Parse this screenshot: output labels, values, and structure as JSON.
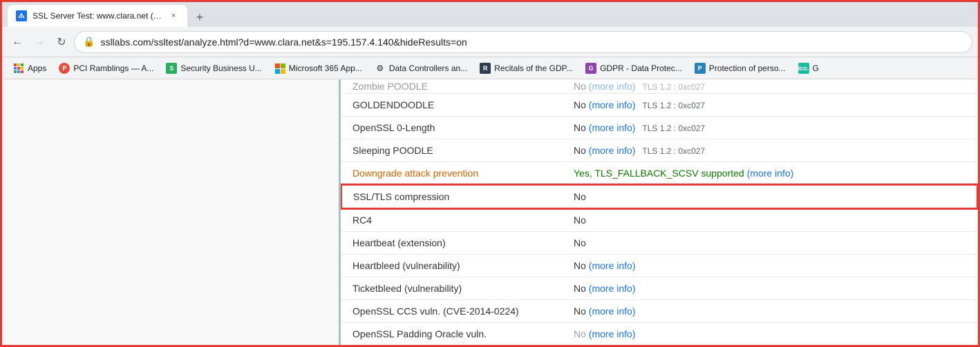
{
  "browser": {
    "tab": {
      "favicon_text": "S",
      "title": "SSL Server Test: www.clara.net (P...",
      "close_label": "×",
      "new_tab_label": "+"
    },
    "nav": {
      "back_label": "←",
      "forward_label": "→",
      "reload_label": "↻",
      "url": "ssllabs.com/ssltest/analyze.html?d=www.clara.net&s=195.157.4.140&hideResults=on",
      "lock_symbol": "🔒"
    },
    "bookmarks": [
      {
        "id": "apps",
        "label": "Apps",
        "type": "apps"
      },
      {
        "id": "pci",
        "label": "PCI Ramblings — A...",
        "color": "#e74c3c"
      },
      {
        "id": "security",
        "label": "Security Business U...",
        "color": "#27ae60"
      },
      {
        "id": "microsoft",
        "label": "Microsoft 365 App...",
        "color": "#f39c12"
      },
      {
        "id": "data-ctrl",
        "label": "Data Controllers an...",
        "color": "#f1c40f"
      },
      {
        "id": "recitals",
        "label": "Recitals of the GDP...",
        "color": "#2c3e50"
      },
      {
        "id": "gdpr-data",
        "label": "GDPR - Data Protec...",
        "color": "#8e44ad"
      },
      {
        "id": "protection",
        "label": "Protection of perso...",
        "color": "#2980b9"
      },
      {
        "id": "ico",
        "label": "G",
        "color": "#1abc9c"
      }
    ]
  },
  "table": {
    "rows": [
      {
        "id": "zombie-poodle",
        "label": "Zombie POODLE",
        "value": "No",
        "extra": "(more info)",
        "extra2": "TLS 1.2 : 0xc027",
        "cut": true
      },
      {
        "id": "goldendoodle",
        "label": "GOLDENDOODLE",
        "value": "No",
        "extra": "(more info)",
        "extra2": "TLS 1.2 : 0xc027",
        "cut": false
      },
      {
        "id": "openssl-0-length",
        "label": "OpenSSL 0-Length",
        "value": "No",
        "extra": "(more info)",
        "extra2": "TLS 1.2 : 0xc027",
        "cut": false
      },
      {
        "id": "sleeping-poodle",
        "label": "Sleeping POODLE",
        "value": "No",
        "extra": "(more info)",
        "extra2": "TLS 1.2 : 0xc027",
        "cut": false
      },
      {
        "id": "downgrade",
        "label": "Downgrade attack prevention",
        "value_green": "Yes, TLS_FALLBACK_SCSV supported",
        "extra": "(more info)",
        "downgrade": true,
        "cut": false
      },
      {
        "id": "ssl-tls-compression",
        "label": "SSL/TLS compression",
        "value": "No",
        "highlighted": true,
        "cut": false
      },
      {
        "id": "rc4",
        "label": "RC4",
        "value": "No",
        "cut": false
      },
      {
        "id": "heartbeat",
        "label": "Heartbeat (extension)",
        "value": "No",
        "cut": false
      },
      {
        "id": "heartbleed",
        "label": "Heartbleed (vulnerability)",
        "value": "No",
        "extra": "(more info)",
        "cut": false
      },
      {
        "id": "ticketbleed",
        "label": "Ticketbleed (vulnerability)",
        "value": "No",
        "extra": "(more info)",
        "cut": false
      },
      {
        "id": "openssl-ccs",
        "label": "OpenSSL CCS vuln. (CVE-2014-0224)",
        "value": "No",
        "extra": "(more info)",
        "cut": false
      },
      {
        "id": "openssl-padding",
        "label": "OpenSSL Padding Oracle vuln.",
        "value": "No",
        "extra": "(more info)",
        "cut_bottom": true
      }
    ]
  }
}
